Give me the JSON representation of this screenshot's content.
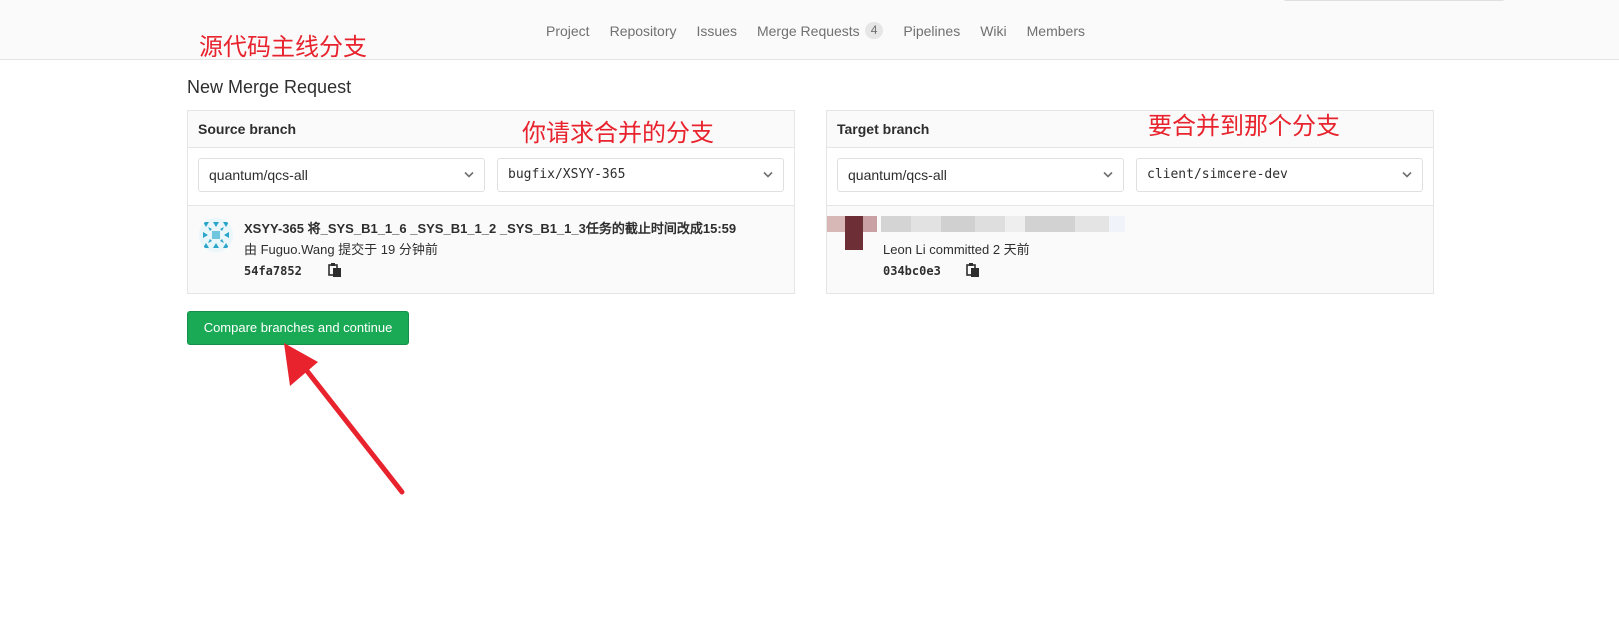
{
  "nav": {
    "items": [
      "Project",
      "Repository",
      "Issues",
      "Merge Requests",
      "Pipelines",
      "Wiki",
      "Members"
    ],
    "merge_requests_count": "4"
  },
  "annotations": {
    "mainline": "源代码主线分支",
    "source_hint": "你请求合并的分支",
    "target_hint": "要合并到那个分支"
  },
  "page_title": "New Merge Request",
  "source": {
    "heading": "Source branch",
    "project": "quantum/qcs-all",
    "branch": "bugfix/XSYY-365",
    "commit": {
      "title": "XSYY-365 将_SYS_B1_1_6 _SYS_B1_1_2 _SYS_B1_1_3任务的截止时间改成15:59",
      "meta": "由 Fuguo.Wang 提交于 19 分钟前",
      "sha": "54fa7852"
    }
  },
  "target": {
    "heading": "Target branch",
    "project": "quantum/qcs-all",
    "branch": "client/simcere-dev",
    "commit": {
      "meta": "Leon Li committed 2 天前",
      "sha": "034bc0e3"
    }
  },
  "compare_button": "Compare branches and continue",
  "colors": {
    "accent_green": "#1aaa55",
    "annotation_red": "#e8232d"
  },
  "icons": {
    "chevron": "chevron-down-icon",
    "copy": "clipboard-icon",
    "avatar": "identicon-avatar"
  }
}
